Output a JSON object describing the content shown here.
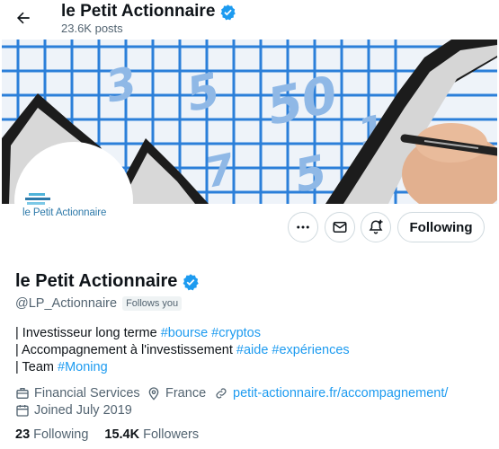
{
  "header": {
    "back_icon": "arrow-left-icon",
    "title": "le Petit Actionnaire",
    "posts_count": "23.6K posts"
  },
  "avatar": {
    "label": "le Petit Actionnaire"
  },
  "actions": {
    "more_icon": "more-horizontal-icon",
    "message_icon": "envelope-icon",
    "notify_icon": "bell-plus-icon",
    "follow_label": "Following"
  },
  "profile": {
    "name": "le Petit Actionnaire",
    "handle": "@LP_Actionnaire",
    "follows_you": "Follows you",
    "verified_icon": "verified-badge-icon",
    "accent_color": "#1d9bf0"
  },
  "bio": {
    "line1": {
      "prefix": "| Investisseur long terme ",
      "tag1": "#bourse",
      "sep": " ",
      "tag2": "#cryptos"
    },
    "line2": {
      "prefix": "| Accompagnement à l'investissement ",
      "tag1": "#aide",
      "sep": " ",
      "tag2": "#expériences"
    },
    "line3": {
      "prefix": "| Team ",
      "tag1": "#Moning"
    }
  },
  "meta": {
    "category": "Financial Services",
    "location": "France",
    "website": "petit-actionnaire.fr/accompagnement/",
    "joined": "Joined July 2019"
  },
  "stats": {
    "following_count": "23",
    "following_label": "Following",
    "followers_count": "15.4K",
    "followers_label": "Followers"
  }
}
